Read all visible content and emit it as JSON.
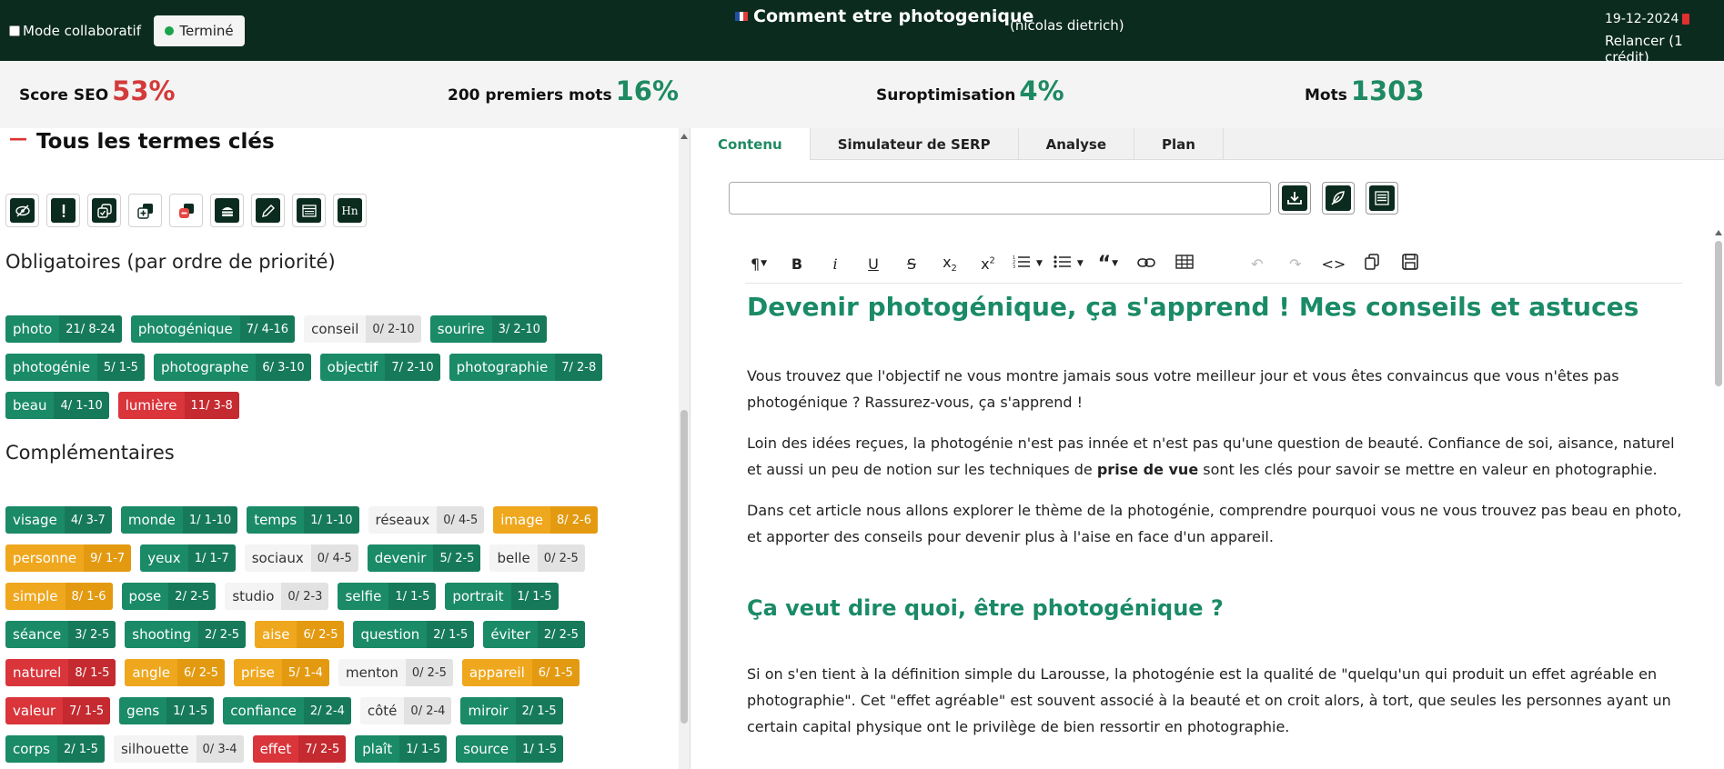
{
  "header": {
    "collab_label": "Mode collaboratif",
    "status_label": "Terminé",
    "title": "Comment etre photogenique",
    "author": "(nicolas dietrich)",
    "date": "19-12-2024",
    "relaunch": "Relancer (1 crédit)",
    "flag_colors": [
      "#1f4ea3",
      "#ffffff",
      "#e03a3a"
    ]
  },
  "scores": [
    {
      "label": "Score SEO",
      "value": "53%",
      "color": "#d33a3a"
    },
    {
      "label": "200 premiers mots",
      "value": "16%",
      "color": "#1e8a62"
    },
    {
      "label": "Suroptimisation",
      "value": "4%",
      "color": "#1e8a62"
    },
    {
      "label": "Mots",
      "value": "1303",
      "color": "#1e8a62"
    }
  ],
  "left": {
    "section_title": "Tous les termes clés",
    "tools": [
      "eye-off-icon",
      "exclamation-icon",
      "copy-check-icon",
      "copy-plus-icon",
      "copy-minus-icon",
      "burger-icon",
      "pencil-icon",
      "table-list-icon",
      "hn-icon"
    ],
    "hn_label": "Hn",
    "required_title": "Obligatoires (par ordre de priorité)",
    "required_chips": [
      {
        "name": "photo",
        "count": "21/ 8-24",
        "status": "green"
      },
      {
        "name": "photogénique",
        "count": "7/ 4-16",
        "status": "green"
      },
      {
        "name": "conseil",
        "count": "0/ 2-10",
        "status": "gray"
      },
      {
        "name": "sourire",
        "count": "3/ 2-10",
        "status": "green"
      },
      {
        "name": "photogénie",
        "count": "5/ 1-5",
        "status": "green"
      },
      {
        "name": "photographe",
        "count": "6/ 3-10",
        "status": "green"
      },
      {
        "name": "objectif",
        "count": "7/ 2-10",
        "status": "green"
      },
      {
        "name": "photographie",
        "count": "7/ 2-8",
        "status": "green"
      },
      {
        "name": "beau",
        "count": "4/ 1-10",
        "status": "green"
      },
      {
        "name": "lumière",
        "count": "11/ 3-8",
        "status": "red"
      }
    ],
    "complementary_title": "Complémentaires",
    "complementary_chips": [
      {
        "name": "visage",
        "count": "4/ 3-7",
        "status": "green"
      },
      {
        "name": "monde",
        "count": "1/ 1-10",
        "status": "green"
      },
      {
        "name": "temps",
        "count": "1/ 1-10",
        "status": "green"
      },
      {
        "name": "réseaux",
        "count": "0/ 4-5",
        "status": "gray"
      },
      {
        "name": "image",
        "count": "8/ 2-6",
        "status": "amber"
      },
      {
        "name": "personne",
        "count": "9/ 1-7",
        "status": "amber"
      },
      {
        "name": "yeux",
        "count": "1/ 1-7",
        "status": "green"
      },
      {
        "name": "sociaux",
        "count": "0/ 4-5",
        "status": "gray"
      },
      {
        "name": "devenir",
        "count": "5/ 2-5",
        "status": "green"
      },
      {
        "name": "belle",
        "count": "0/ 2-5",
        "status": "gray"
      },
      {
        "name": "simple",
        "count": "8/ 1-6",
        "status": "amber"
      },
      {
        "name": "pose",
        "count": "2/ 2-5",
        "status": "green"
      },
      {
        "name": "studio",
        "count": "0/ 2-3",
        "status": "gray"
      },
      {
        "name": "selfie",
        "count": "1/ 1-5",
        "status": "green"
      },
      {
        "name": "portrait",
        "count": "1/ 1-5",
        "status": "green"
      },
      {
        "name": "séance",
        "count": "3/ 2-5",
        "status": "green"
      },
      {
        "name": "shooting",
        "count": "2/ 2-5",
        "status": "green"
      },
      {
        "name": "aise",
        "count": "6/ 2-5",
        "status": "amber"
      },
      {
        "name": "question",
        "count": "2/ 1-5",
        "status": "green"
      },
      {
        "name": "éviter",
        "count": "2/ 2-5",
        "status": "green"
      },
      {
        "name": "naturel",
        "count": "8/ 1-5",
        "status": "red"
      },
      {
        "name": "angle",
        "count": "6/ 2-5",
        "status": "amber"
      },
      {
        "name": "prise",
        "count": "5/ 1-4",
        "status": "amber"
      },
      {
        "name": "menton",
        "count": "0/ 2-5",
        "status": "gray"
      },
      {
        "name": "appareil",
        "count": "6/ 1-5",
        "status": "amber"
      },
      {
        "name": "valeur",
        "count": "7/ 1-5",
        "status": "red"
      },
      {
        "name": "gens",
        "count": "1/ 1-5",
        "status": "green"
      },
      {
        "name": "confiance",
        "count": "2/ 2-4",
        "status": "green"
      },
      {
        "name": "côté",
        "count": "0/ 2-4",
        "status": "gray"
      },
      {
        "name": "miroir",
        "count": "2/ 1-5",
        "status": "green"
      },
      {
        "name": "corps",
        "count": "2/ 1-5",
        "status": "green"
      },
      {
        "name": "silhouette",
        "count": "0/ 3-4",
        "status": "gray"
      },
      {
        "name": "effet",
        "count": "7/ 2-5",
        "status": "red"
      },
      {
        "name": "plaît",
        "count": "1/ 1-5",
        "status": "green"
      },
      {
        "name": "source",
        "count": "1/ 1-5",
        "status": "green"
      }
    ]
  },
  "right": {
    "tabs": [
      "Contenu",
      "Simulateur de SERP",
      "Analyse",
      "Plan"
    ],
    "active_tab": "Contenu",
    "editor": {
      "h1": "Devenir photogénique, ça s'apprend ! Mes conseils et astuces",
      "p1": "Vous trouvez que l'objectif ne vous montre jamais sous votre meilleur jour et vous êtes convaincus que vous n'êtes pas photogénique ? Rassurez-vous, ça s'apprend !",
      "p2_start": "Loin des idées reçues, la photogénie n'est pas innée et n'est pas qu'une question de beauté. Confiance de soi, aisance, naturel et aussi un peu de notion sur les techniques de ",
      "p2_bold": "prise de vue",
      "p2_end": " sont les clés pour savoir se mettre en valeur en photographie.",
      "p3": "Dans cet article nous allons explorer le thème de la photogénie, comprendre pourquoi vous ne vous trouvez pas beau en photo, et apporter des conseils pour devenir plus à l'aise en face d'un appareil.",
      "h2": "Ça veut dire quoi, être photogénique ?",
      "p4": "Si on s'en tient à la définition simple du Larousse, la photogénie est la qualité de \"quelqu'un qui produit un effet agréable en photographie\". Cet \"effet agréable\" est souvent associé à la beauté et on croit alors, à tort, que seules les personnes ayant un certain capital physique ont le privilège de bien ressortir en photographie."
    }
  },
  "colors": {
    "dark_green": "#0b2b1f",
    "accent_green": "#1a8a67",
    "red": "#d9353b",
    "amber": "#efa71e",
    "gray_chip": "#f4f4f4"
  }
}
